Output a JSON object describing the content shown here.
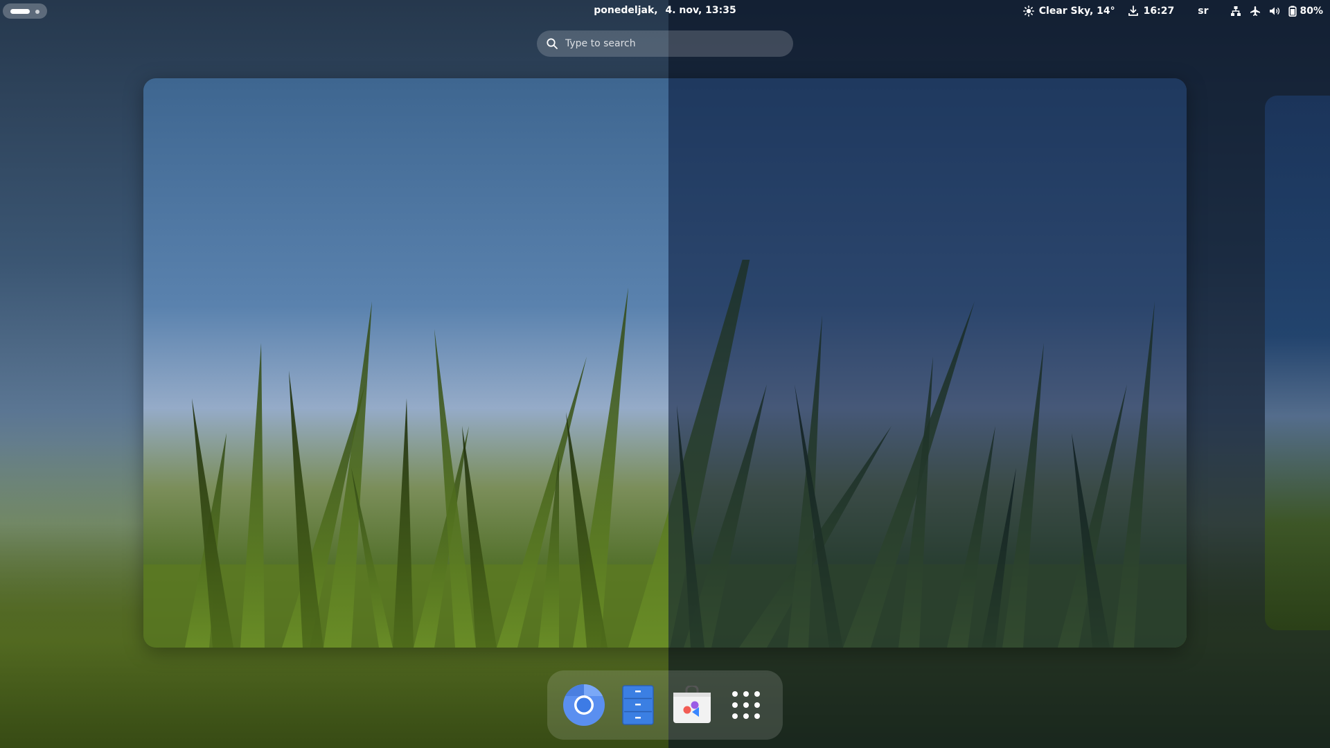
{
  "topbar": {
    "day": "ponedeljak,",
    "date_time": "4. nov, 13:35",
    "weather": "Clear Sky, 14°",
    "time": "16:27",
    "keyboard_layout": "sr",
    "battery": "80%"
  },
  "search": {
    "placeholder": "Type to search"
  },
  "dock": {
    "apps": [
      "chromium-icon",
      "files-icon",
      "software-store-icon",
      "show-apps-icon"
    ]
  },
  "colors": {
    "accent": "#4a86e8",
    "files_blue": "#3b7fe3"
  }
}
